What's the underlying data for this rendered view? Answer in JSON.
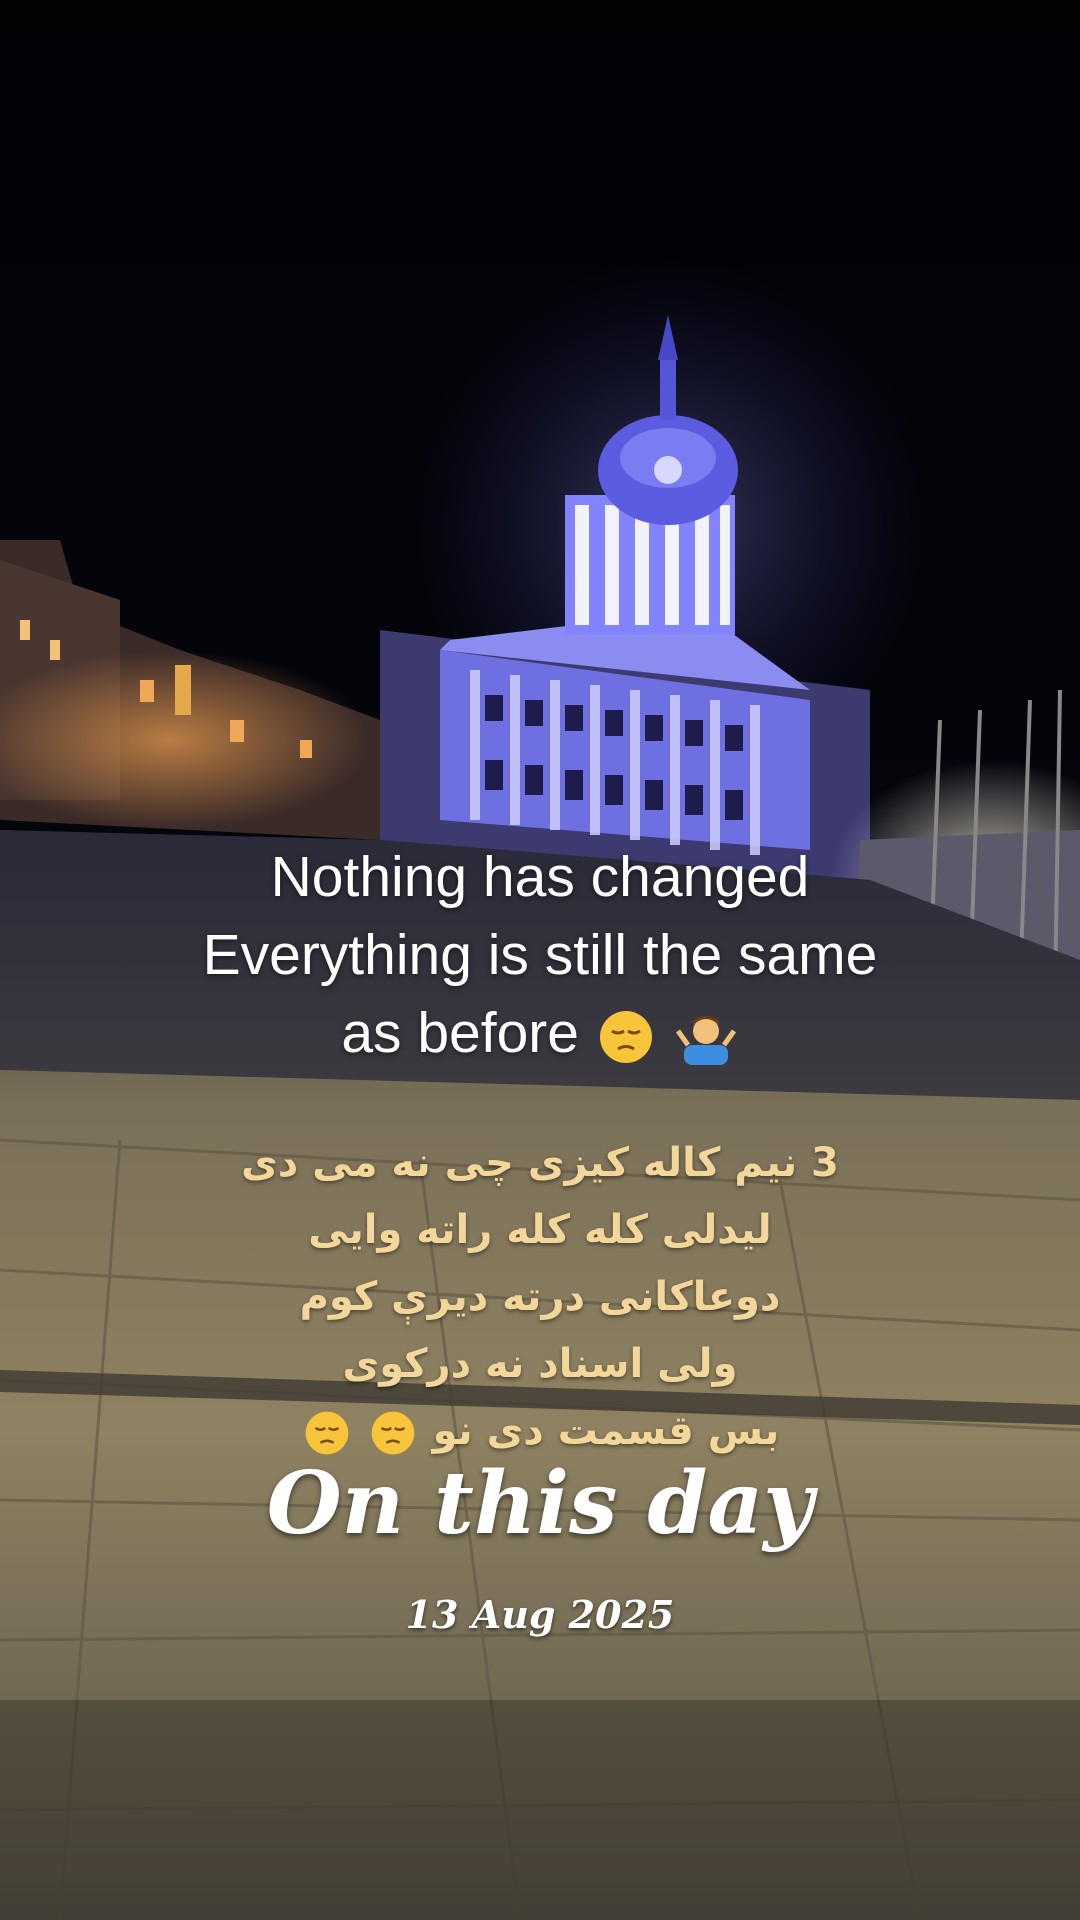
{
  "caption_en": {
    "lines": [
      "Nothing has changed",
      "Everything is still the same",
      "as before"
    ],
    "emoji": [
      "pensive-face-emoji",
      "man-shrugging-emoji"
    ]
  },
  "caption_ps": {
    "lines": [
      "3 نیم کاله کیزی چی نه می دی",
      "لیدلی کله کله راته وایی",
      "دوعاکانی درته دیرې کوم",
      "ولی اسناد نه درکوی",
      "بس قسمت دی نو"
    ],
    "emoji": [
      "pensive-face-emoji",
      "pensive-face-emoji"
    ]
  },
  "memory": {
    "title": "On this day",
    "date": "13 Aug 2025"
  },
  "colors": {
    "night_sky": "#05050c",
    "dome_light": "#6f74ff",
    "facade_light": "#8f90ff",
    "street_lights": "#f2a24a",
    "pavement": "#8c7e60",
    "persian_text": "#f3d79a"
  }
}
